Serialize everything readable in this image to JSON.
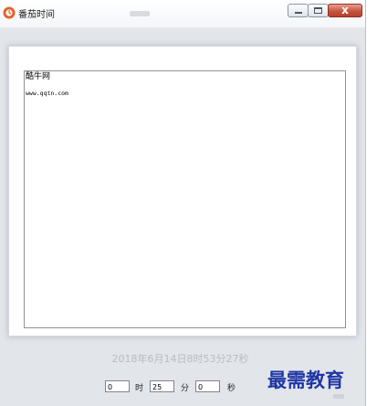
{
  "window": {
    "title": "番茄时间",
    "close_glyph": "x"
  },
  "viewer": {
    "line1": "酷牛网",
    "line2": "www.qqtn.com"
  },
  "datetime_text": "2018年6月14日8时53分27秒",
  "timer": {
    "hours_value": "0",
    "hours_unit": "时",
    "minutes_value": "25",
    "minutes_unit": "分",
    "seconds_value": "0",
    "seconds_unit": "秒"
  },
  "watermark": "最需教育",
  "colors": {
    "accent_icon": "#e4632a",
    "watermark": "#1f36a5",
    "datetime_text": "#b7bdc6"
  }
}
